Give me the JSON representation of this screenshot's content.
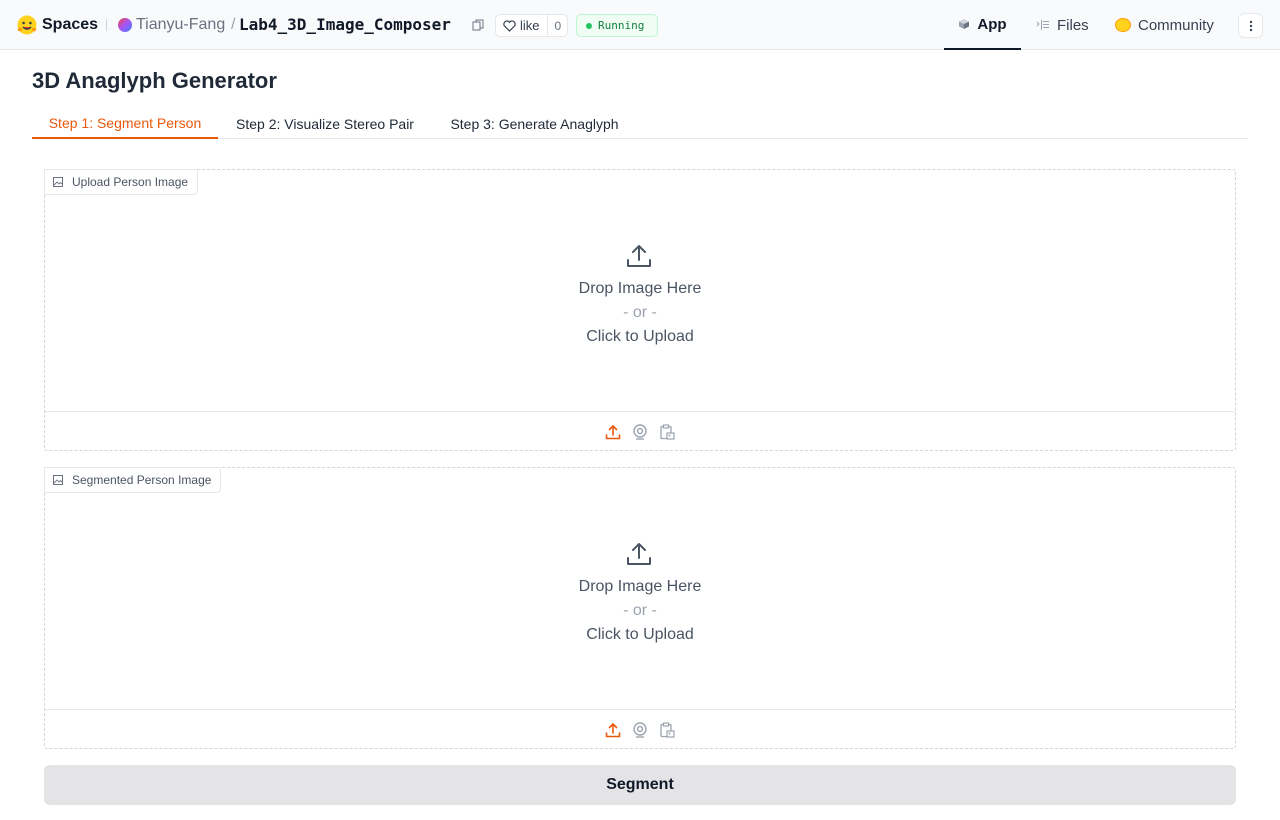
{
  "header": {
    "brand": "Spaces",
    "owner": "Tianyu-Fang",
    "separator": "/",
    "repo": "Lab4_3D_Image_Composer",
    "like_label": "like",
    "like_count": "0",
    "status": "Running",
    "nav": [
      {
        "label": "App",
        "icon": "cube-icon",
        "active": true
      },
      {
        "label": "Files",
        "icon": "files-icon",
        "active": false
      },
      {
        "label": "Community",
        "icon": "community-icon",
        "active": false
      }
    ]
  },
  "main": {
    "title": "3D Anaglyph Generator",
    "tabs": [
      {
        "label": "Step 1: Segment Person",
        "active": true
      },
      {
        "label": "Step 2: Visualize Stereo Pair",
        "active": false
      },
      {
        "label": "Step 3: Generate Anaglyph",
        "active": false
      }
    ],
    "image_inputs": [
      {
        "label": "Upload Person Image",
        "drop_text": "Drop Image Here",
        "or_text": "- or -",
        "click_text": "Click to Upload",
        "sources": [
          "upload-icon",
          "webcam-icon",
          "clipboard-icon"
        ]
      },
      {
        "label": "Segmented Person Image",
        "drop_text": "Drop Image Here",
        "or_text": "- or -",
        "click_text": "Click to Upload",
        "sources": [
          "upload-icon",
          "webcam-icon",
          "clipboard-icon"
        ]
      }
    ],
    "segment_button": "Segment"
  },
  "colors": {
    "accent": "#ea580c",
    "status_green": "#22c55e",
    "button_bg": "#e4e4e7"
  }
}
